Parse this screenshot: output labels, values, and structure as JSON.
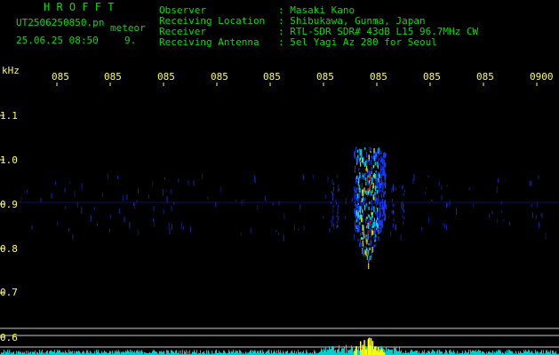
{
  "header": {
    "brand": "H R O F F T",
    "filename": "UT2506250850.pn",
    "meteor_word": "meteor",
    "date_time": "25.06.25 08:50",
    "count": "9.",
    "fields": [
      {
        "label": "Observer",
        "value": ": Masaki Kano"
      },
      {
        "label": "Receiving Location",
        "value": ": Shibukawa, Gunma, Japan"
      },
      {
        "label": "Receiver",
        "value": ": RTL-SDR SDR# 43dB L15 96.7MHz CW"
      },
      {
        "label": "Receiving Antenna",
        "value": ": 5el Yagi Az 280 for Seoul"
      }
    ]
  },
  "axis": {
    "unit": "kHz",
    "y_labels": [
      "1.1",
      "1.0",
      "0.9",
      "0.8",
      "0.7",
      "0.6"
    ],
    "time_ticks": [
      "085",
      "085",
      "085",
      "085",
      "085",
      "085",
      "085",
      "085",
      "085",
      "0900"
    ]
  },
  "colors": {
    "text_green": "#00e000",
    "text_yellow": "#ffff40",
    "spectrum_bg": "#000000",
    "gridline": "#c8c8c8",
    "signal_blue": "#1a3cff",
    "signal_cyan": "#00ffff",
    "signal_yellow": "#ffff00",
    "signal_red": "#ff2020"
  }
}
